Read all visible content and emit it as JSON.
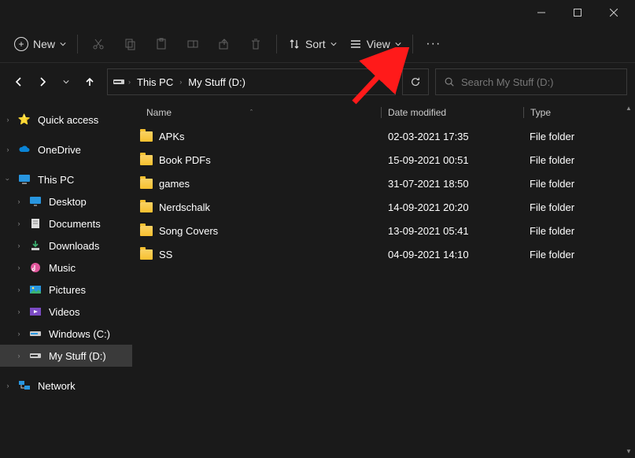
{
  "toolbar": {
    "new_label": "New",
    "sort_label": "Sort",
    "view_label": "View"
  },
  "breadcrumb": {
    "root": "This PC",
    "leaf": "My Stuff (D:)"
  },
  "search": {
    "placeholder": "Search My Stuff (D:)"
  },
  "sidebar": {
    "quick_access": "Quick access",
    "onedrive": "OneDrive",
    "this_pc": "This PC",
    "desktop": "Desktop",
    "documents": "Documents",
    "downloads": "Downloads",
    "music": "Music",
    "pictures": "Pictures",
    "videos": "Videos",
    "windows_c": "Windows (C:)",
    "mystuff_d": "My Stuff (D:)",
    "network": "Network"
  },
  "columns": {
    "name": "Name",
    "date": "Date modified",
    "type": "Type"
  },
  "files": [
    {
      "name": "APKs",
      "date": "02-03-2021 17:35",
      "type": "File folder"
    },
    {
      "name": "Book PDFs",
      "date": "15-09-2021 00:51",
      "type": "File folder"
    },
    {
      "name": "games",
      "date": "31-07-2021 18:50",
      "type": "File folder"
    },
    {
      "name": "Nerdschalk",
      "date": "14-09-2021 20:20",
      "type": "File folder"
    },
    {
      "name": "Song Covers",
      "date": "13-09-2021 05:41",
      "type": "File folder"
    },
    {
      "name": "SS",
      "date": "04-09-2021 14:10",
      "type": "File folder"
    }
  ]
}
